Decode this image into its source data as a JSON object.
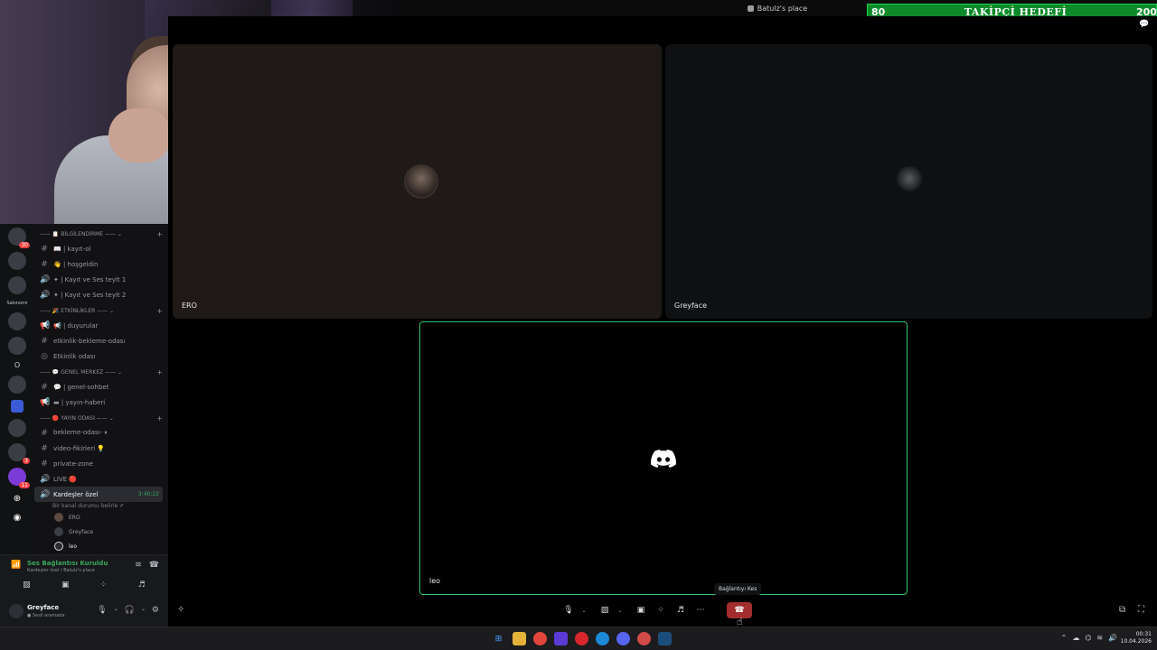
{
  "window": {
    "title": "Batulz's place"
  },
  "goal": {
    "from": "80",
    "label": "TAKİPÇİ HEDEFİ",
    "to": "200",
    "color": "#0e8a2a"
  },
  "rail": {
    "badges": [
      "30",
      "3",
      "11"
    ],
    "label": "Sakınomi",
    "letter": "O"
  },
  "channels": {
    "categories": [
      {
        "label": "—— 📋 BİLGİLENDİRME —— ⌄"
      },
      {
        "label": "—— 🎉 ETKİNLİKLER —— ⌄"
      },
      {
        "label": "—— 💬 GENEL MERKEZ —— ⌄"
      },
      {
        "label": "—— 🔴 YAYIN ODASI —— ⌄"
      }
    ],
    "items": [
      {
        "symbol": "#",
        "label": "📖 | kayıt-ol"
      },
      {
        "symbol": "#",
        "label": "👋 | hoşgeldin"
      },
      {
        "symbol": "🔊",
        "label": "✦ | Kayıt ve Ses teyit 1"
      },
      {
        "symbol": "🔊",
        "label": "✦ | Kayıt ve Ses teyit 2"
      },
      {
        "symbol": "📢",
        "label": "📢 | duyurular"
      },
      {
        "symbol": "#",
        "label": "etkinlik-bekleme-odası"
      },
      {
        "symbol": "◎",
        "label": "Etkinlik odası"
      },
      {
        "symbol": "#",
        "label": "💬 | genel-sohbet"
      },
      {
        "symbol": "📢",
        "label": "▬ | yayın-haberi"
      },
      {
        "symbol": "#",
        "label": "bekleme-odası- ⏸"
      },
      {
        "symbol": "#",
        "label": "video-fikirleri 💡"
      },
      {
        "symbol": "#",
        "label": "private-zone"
      },
      {
        "symbol": "🔊",
        "label": "LIVE 🔴"
      }
    ],
    "active": {
      "symbol": "🔊",
      "label": "Kardeşler özel",
      "timer": "3:40:22",
      "status": "Bir kanal durumu belirle ✐"
    },
    "members": [
      "ERO",
      "Greyface",
      "leo"
    ]
  },
  "voice": {
    "status": "Ses Bağlantısı Kuruldu",
    "location": "Kardeşler özel / Batulz's place"
  },
  "user": {
    "name": "Greyface",
    "status": "● Sesli aramada"
  },
  "stage": {
    "tiles": [
      {
        "name": "ERO"
      },
      {
        "name": "Greyface"
      },
      {
        "name": "leo"
      }
    ]
  },
  "controls": {
    "tooltip": "Bağlantıyı Kes"
  },
  "taskbar": {
    "time": "00:31",
    "date": "10.04.2026"
  },
  "colors": {
    "accent": "#2fc36a",
    "hangup": "#a12d2f",
    "online": "#3ba55c"
  }
}
